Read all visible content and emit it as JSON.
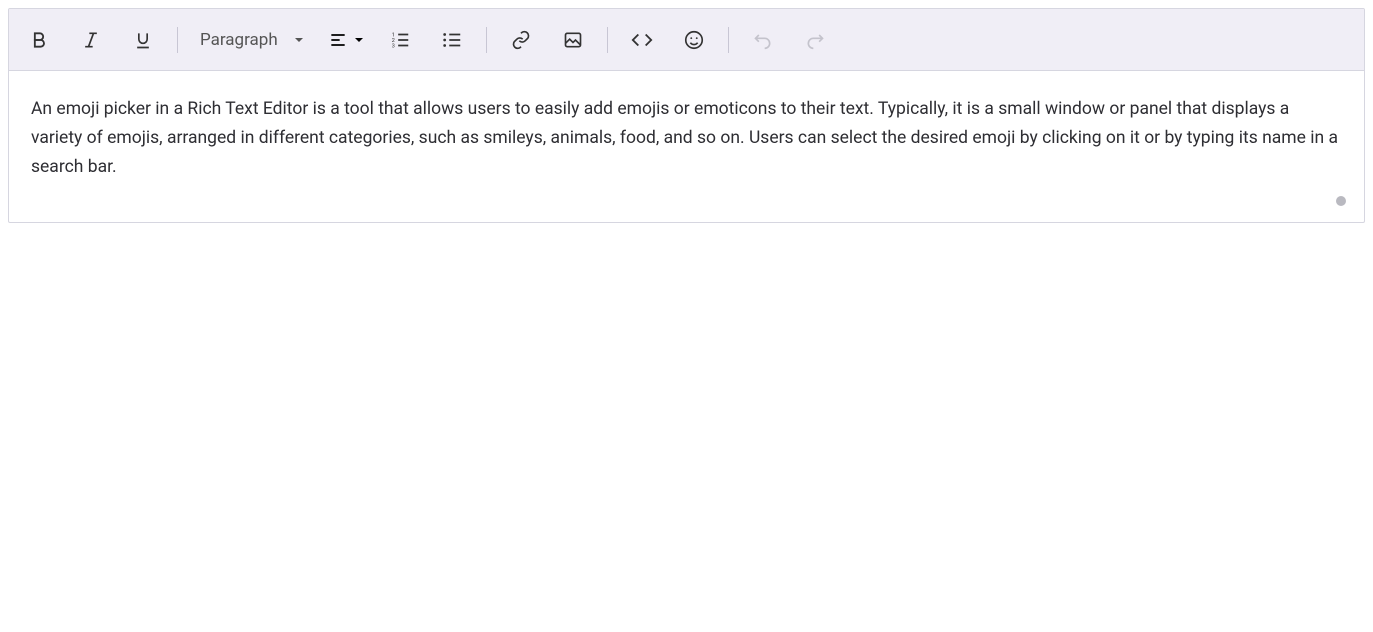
{
  "toolbar": {
    "format_label": "Paragraph"
  },
  "content": {
    "text": "An emoji picker in a Rich Text Editor is a tool that allows users to easily add emojis or emoticons to their text. Typically, it is a small window or panel that displays a variety of emojis, arranged in different categories, such as smileys, animals, food, and so on. Users can select the desired emoji by clicking on it or by typing its name in a search bar."
  }
}
